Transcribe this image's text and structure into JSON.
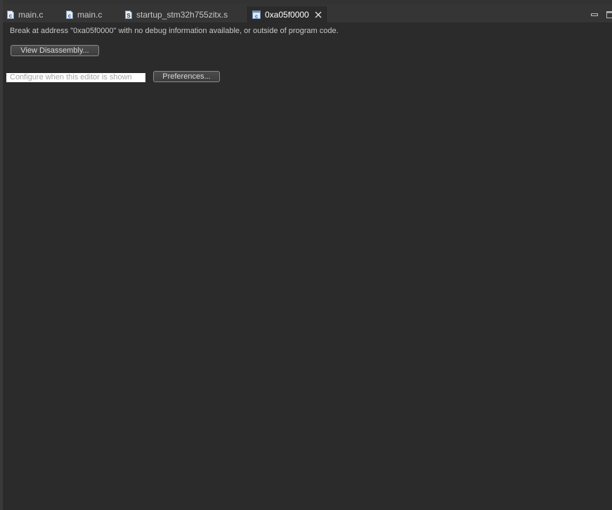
{
  "tabs": [
    {
      "label": "main.c",
      "icon": "c-source-file-icon",
      "icon_letter": "c"
    },
    {
      "label": "main.c",
      "icon": "c-source-file-icon",
      "icon_letter": "c"
    },
    {
      "label": "startup_stm32h755zitx.s",
      "icon": "assembly-file-icon",
      "icon_letter": "S"
    },
    {
      "label": "0xa05f0000",
      "icon": "c-editor-icon",
      "icon_letter": "c",
      "active": true
    }
  ],
  "editor": {
    "message": "Break at address \"0xa05f0000\" with no debug information available, or outside of program code.",
    "view_disassembly_label": "View Disassembly...",
    "configure_link": "Configure when this editor is shown",
    "preferences_label": "Preferences..."
  },
  "colors": {
    "background": "#2b2b2b",
    "tabbar": "#353535",
    "text": "#c8c8c8",
    "active_tab_text": "#ffffff"
  }
}
